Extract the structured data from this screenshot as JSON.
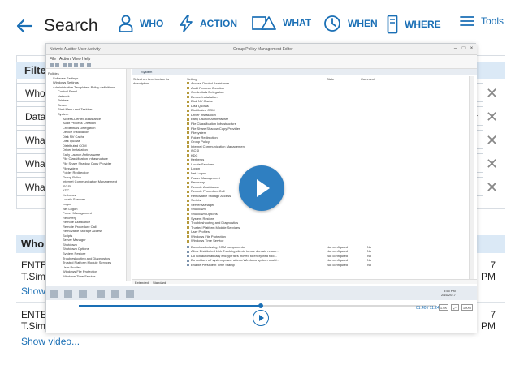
{
  "nav": {
    "search": "Search",
    "who": "WHO",
    "action": "ACTION",
    "what": "WHAT",
    "when": "WHEN",
    "where": "WHERE",
    "tools": "Tools"
  },
  "filters": {
    "header": "Filte",
    "rows": [
      "Who",
      "Data",
      "Wha",
      "Wha",
      "Wha"
    ]
  },
  "results": {
    "header": "Who",
    "entries": [
      {
        "line1": "ENTE",
        "line2": "T.Sim",
        "right1": "7",
        "right2": "PM",
        "link": "Show"
      },
      {
        "line1": "ENTE",
        "line2": "T.Sim",
        "right1": "7",
        "right2": "PM",
        "link": "Show video..."
      }
    ]
  },
  "video": {
    "window_title_left": "Netwrix Auditor User Activity",
    "window_title": "Group Policy Management Editor",
    "menu": [
      "File",
      "Action",
      "View",
      "Help"
    ],
    "tree": [
      "Policies",
      "Software Settings",
      "Windows Settings",
      "Administrative Templates: Policy definitions",
      "Control Panel",
      "Network",
      "Printers",
      "Server",
      "Start Menu and Taskbar",
      "System",
      "Access-Denied Assistance",
      "Audit Process Creation",
      "Credentials Delegation",
      "Device Installation",
      "Disk NV Cache",
      "Disk Quotas",
      "Distributed COM",
      "Driver Installation",
      "Early Launch Antimalware",
      "File Classification Infrastructure",
      "File Share Shadow Copy Provider",
      "Filesystem",
      "Folder Redirection",
      "Group Policy",
      "Internet Communication Management",
      "iSCSI",
      "KDC",
      "Kerberos",
      "Locale Services",
      "Logon",
      "Net Logon",
      "Power Management",
      "Recovery",
      "Remote Assistance",
      "Remote Procedure Call",
      "Removable Storage Access",
      "Scripts",
      "Server Manager",
      "Shutdown",
      "Shutdown Options",
      "System Restore",
      "Troubleshooting and Diagnostics",
      "Trusted Platform Module Services",
      "User Profiles",
      "Windows File Protection",
      "Windows Time Service"
    ],
    "detail_tab": "System",
    "description": "Select an item to view its description.",
    "columns": {
      "setting": "Setting",
      "state": "State",
      "comment": "Comment"
    },
    "settings": [
      "Access-Denied Assistance",
      "Audit Process Creation",
      "Credentials Delegation",
      "Device Installation",
      "Disk NV Cache",
      "Disk Quotas",
      "Distributed COM",
      "Driver Installation",
      "Early Launch Antimalware",
      "File Classification Infrastructure",
      "File Share Shadow Copy Provider",
      "Filesystem",
      "Folder Redirection",
      "Group Policy",
      "Internet Communication Management",
      "iSCSI",
      "KDC",
      "Kerberos",
      "Locale Services",
      "Logon",
      "Net Logon",
      "Power Management",
      "Recovery",
      "Remote Assistance",
      "Remote Procedure Call",
      "Removable Storage Access",
      "Scripts",
      "Server Manager",
      "Shutdown",
      "Shutdown Options",
      "System Restore",
      "Troubleshooting and Diagnostics",
      "Trusted Platform Module Services",
      "User Profiles",
      "Windows File Protection",
      "Windows Time Service"
    ],
    "policies": [
      {
        "name": "Download missing COM components",
        "state": "Not configured",
        "comment": "No"
      },
      {
        "name": "Allow Distributed Link Tracking clients to use domain resour...",
        "state": "Not configured",
        "comment": "No"
      },
      {
        "name": "Do not automatically encrypt files moved to encrypted fold...",
        "state": "Not configured",
        "comment": "No"
      },
      {
        "name": "Do not turn off system power after a Windows system shutd...",
        "state": "Not configured",
        "comment": "No"
      },
      {
        "name": "Enable Persistent Time Stamp",
        "state": "Not configured",
        "comment": "No"
      }
    ],
    "ext_tabs": [
      "Extended",
      "Standard"
    ],
    "tray_time": "3:55 PM",
    "tray_date": "2/16/2017",
    "time_display": "01:40 / 11:24",
    "speed": "1.0X",
    "zoom": "100%",
    "progress": 0.51
  },
  "colors": {
    "accent": "#1a6fb5",
    "play": "#2f7fc1"
  }
}
